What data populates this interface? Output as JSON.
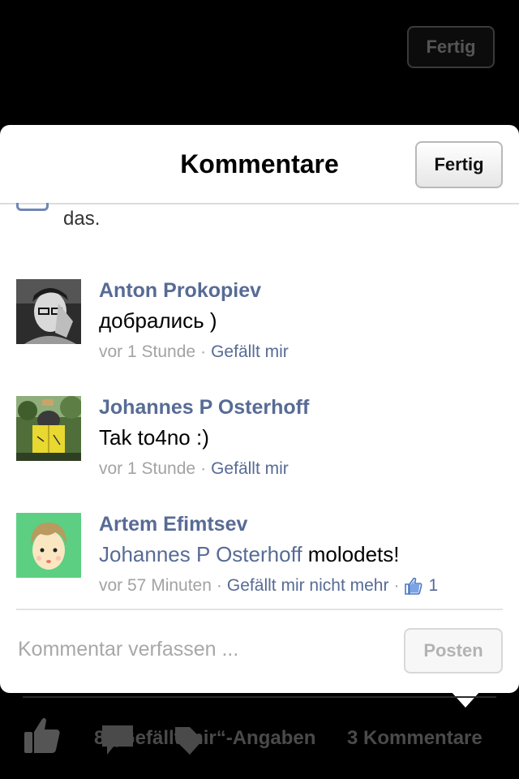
{
  "background": {
    "done_label": "Fertig"
  },
  "sheet": {
    "title": "Kommentare",
    "done_label": "Fertig",
    "partial_text": "das."
  },
  "comments": [
    {
      "author": "Anton Prokopiev",
      "text": "добрались )",
      "time": "vor 1 Stunde",
      "separator": "·",
      "like_action": "Gefällt mir"
    },
    {
      "author": "Johannes P Osterhoff",
      "text": "Tak to4no :)",
      "time": "vor 1 Stunde",
      "separator": "·",
      "like_action": "Gefällt mir"
    },
    {
      "author": "Artem Efimtsev",
      "mention": "Johannes P Osterhoff",
      "text": " molodets!",
      "time": "vor 57 Minuten",
      "separator": "·",
      "like_action": "Gefällt mir nicht mehr",
      "like_count": "1"
    }
  ],
  "composer": {
    "placeholder": "Kommentar verfassen ...",
    "post_label": "Posten"
  },
  "bottom_bar": {
    "likes_text": "8 „Gefällt mir“-Angaben",
    "comments_text": "3 Kommentare"
  },
  "icons": {
    "partial": "like-icon",
    "comment_like": "thumbs-up-icon",
    "bottom_like": "thumbs-up-icon",
    "bottom_comment": "speech-bubble-icon",
    "bottom_share": "share-icon"
  },
  "colors": {
    "link": "#576b95",
    "meta": "#a3a3a3",
    "background": "#000000"
  }
}
